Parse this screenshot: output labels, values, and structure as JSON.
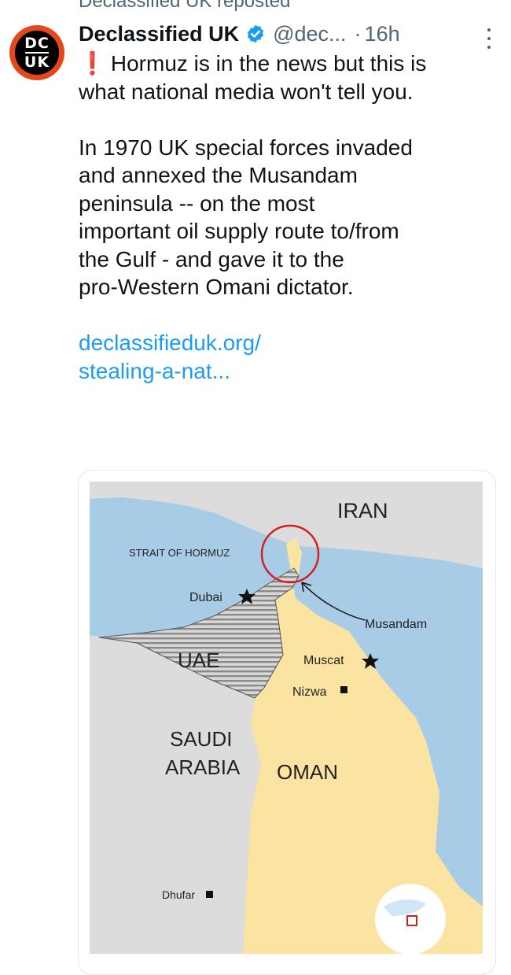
{
  "repost": {
    "label": "Declassified UK reposted"
  },
  "post": {
    "author_name": "Declassified UK",
    "verified": true,
    "handle": "@dec...",
    "separator": "·",
    "time": "16h",
    "avatar": {
      "line1": "DC",
      "line2": "UK",
      "ring_color": "#e3481b"
    },
    "excl_icon": "❗",
    "text_lines": [
      "Hormuz is in the news but this is",
      "what national media won't tell you.",
      "",
      "In 1970 UK special forces invaded",
      "and annexed the Musandam",
      "peninsula -- on the most",
      "important oil supply route to/from",
      "the Gulf - and gave it to the",
      "pro-Western Omani dictator.",
      ""
    ],
    "link_lines": [
      "declassifieduk.org/",
      "stealing-a-nat..."
    ]
  },
  "map": {
    "labels": {
      "iran": "IRAN",
      "strait": "STRAIT OF HORMUZ",
      "dubai": "Dubai",
      "musandam": "Musandam",
      "uae": "UAE",
      "muscat": "Muscat",
      "nizwa": "Nizwa",
      "saudi_line1": "SAUDI",
      "saudi_line2": "ARABIA",
      "oman": "OMAN",
      "dhufar": "Dhufar"
    },
    "colors": {
      "sea": "#a8cbe6",
      "oman": "#fbe3a2",
      "uae": "#c9c9c9",
      "land": "#dcdcdc",
      "circle": "#d62020"
    }
  }
}
